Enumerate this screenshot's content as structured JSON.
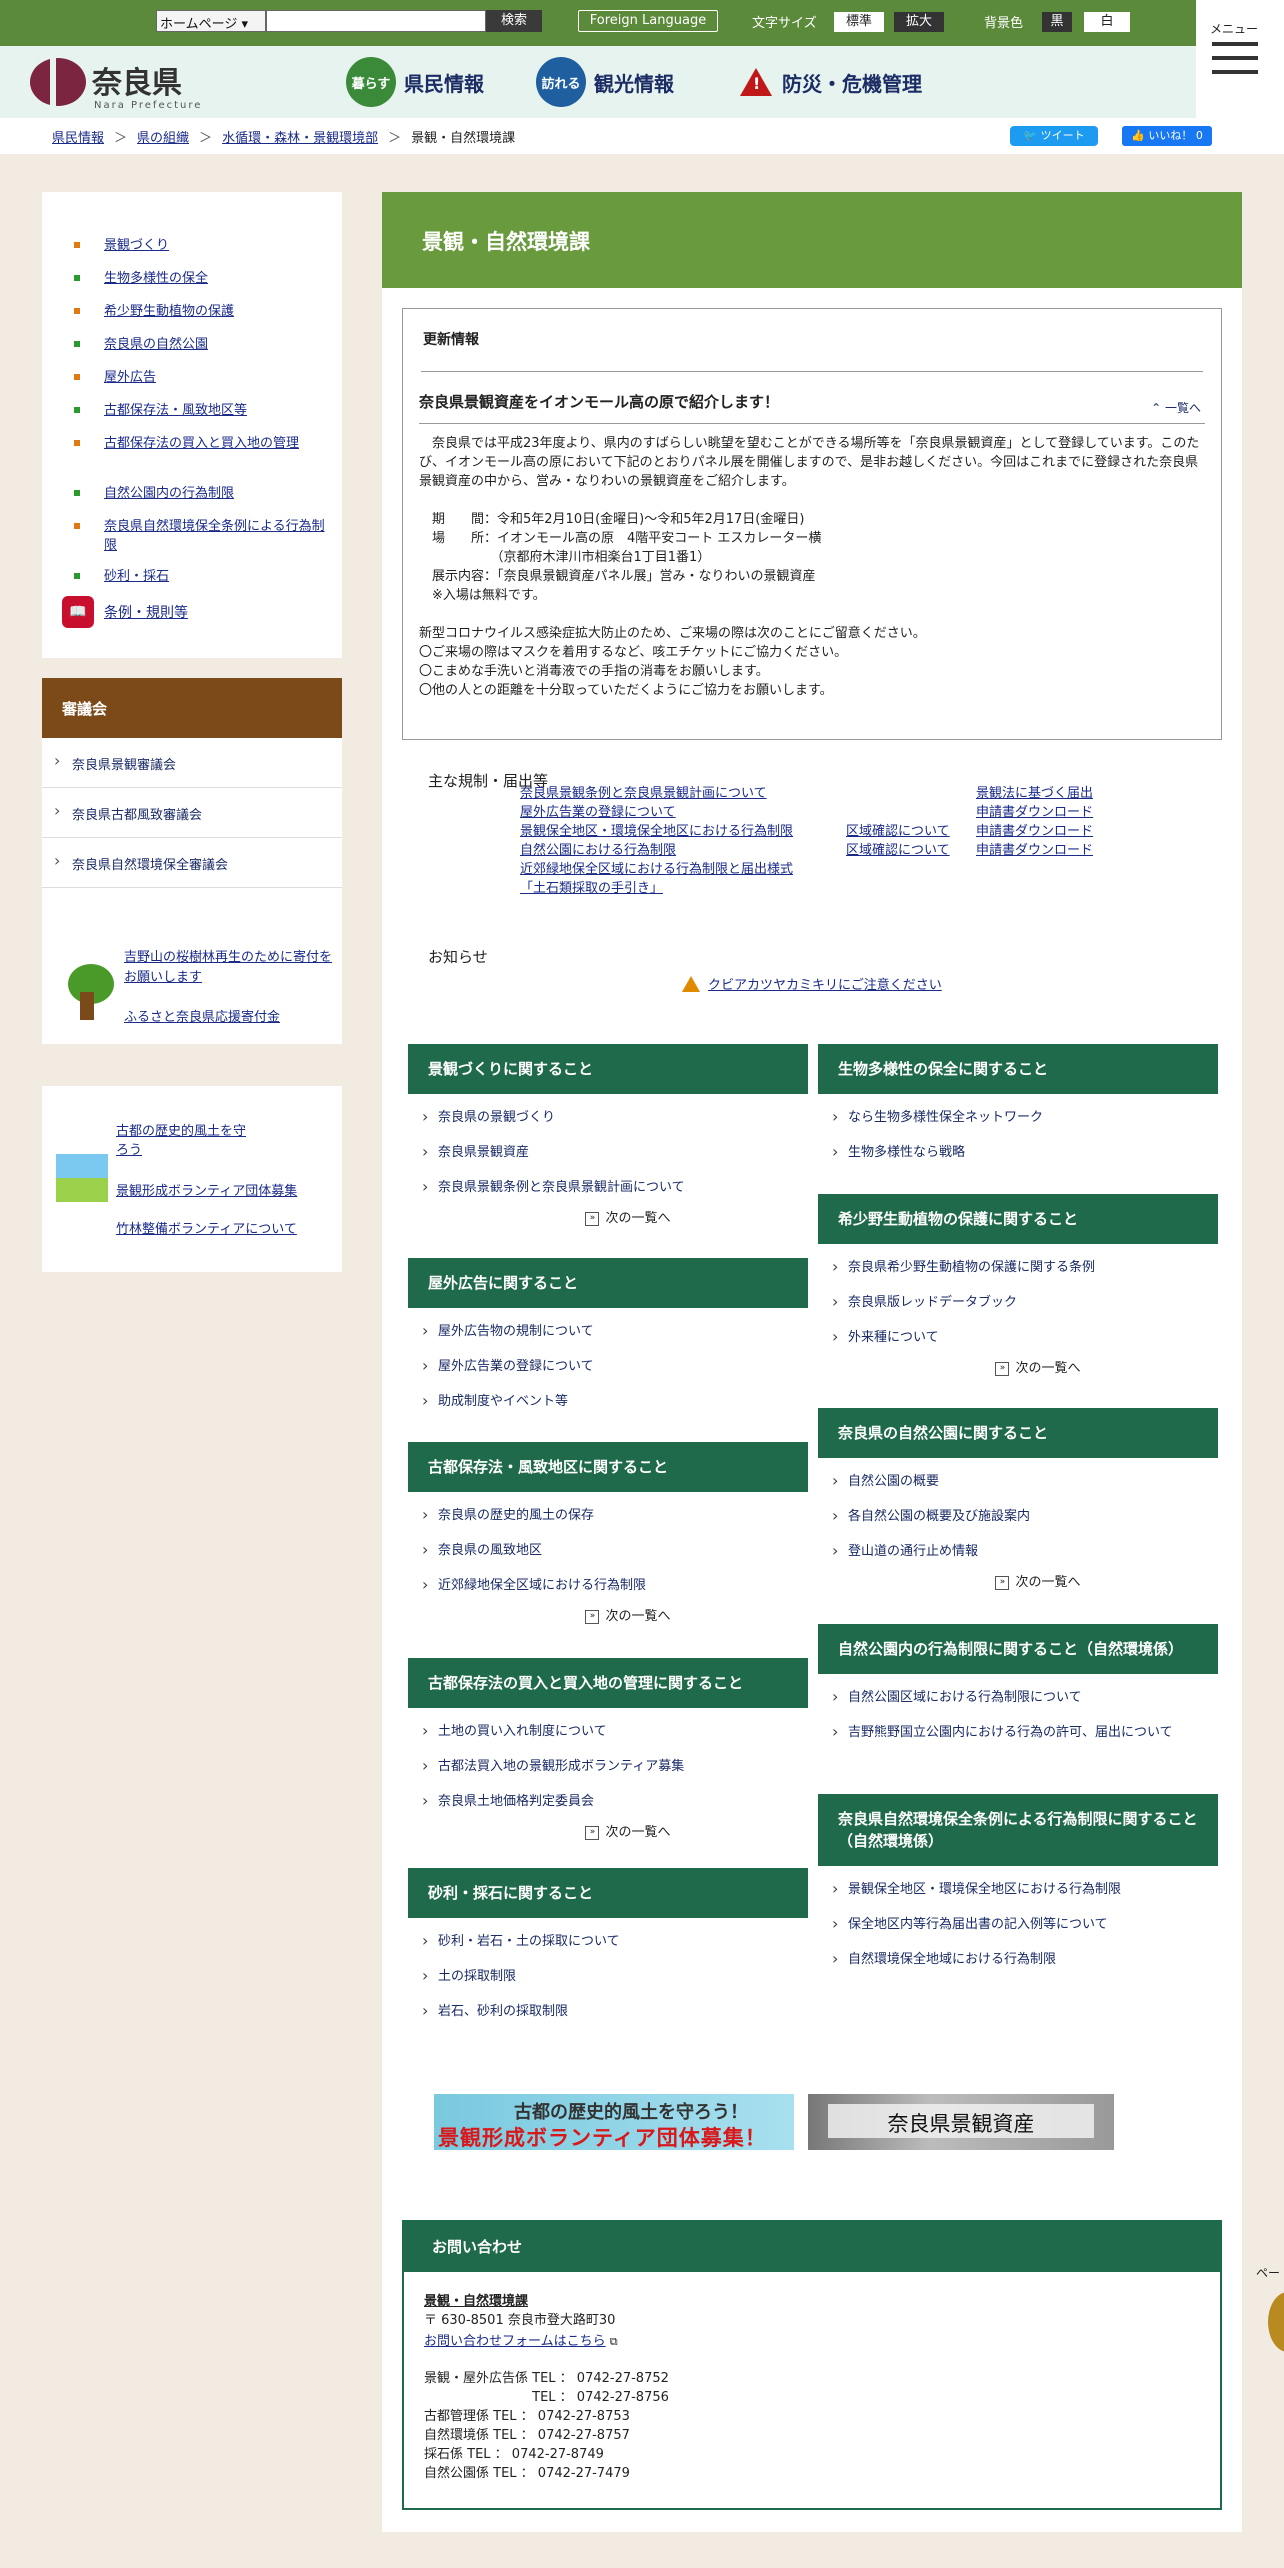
{
  "topbar": {
    "select_value": "ホームページ",
    "search_placeholder": "",
    "search_button": "検索",
    "foreign_language": "Foreign Language",
    "font_size_label": "文字サイズ",
    "font_standard": "標準",
    "font_large": "拡大",
    "bg_label": "背景色",
    "bg_black": "黒",
    "bg_white": "白"
  },
  "header": {
    "logo_text": "奈良県",
    "logo_sub": "Nara Prefecture",
    "nav": [
      {
        "badge": "暮らす",
        "label": "県民情報"
      },
      {
        "badge": "訪れる",
        "label": "観光情報"
      },
      {
        "badge": "",
        "label": "防災・危機管理"
      }
    ],
    "menu_label": "メニュー"
  },
  "breadcrumb": {
    "items": [
      "県民情報",
      "県の組織",
      "水循環・森林・景観環境部",
      "景観・自然環境課"
    ],
    "tweet": "ツイート",
    "like": "いいね！ 0"
  },
  "sidebar": {
    "links": [
      {
        "label": "景観づくり",
        "color": "#e07a10"
      },
      {
        "label": "生物多様性の保全",
        "color": "#2a9a2a"
      },
      {
        "label": "希少野生動植物の保護",
        "color": "#e07a10"
      },
      {
        "label": "奈良県の自然公園",
        "color": "#2a9a2a"
      },
      {
        "label": "屋外広告",
        "color": "#e07a10"
      },
      {
        "label": "古都保存法・風致地区等",
        "color": "#2a9a2a"
      },
      {
        "label": "古都保存法の買入と買入地の管理",
        "color": "#e07a10"
      },
      {
        "label": "自然公園内の行為制限",
        "color": "#2a9a2a"
      },
      {
        "label": "奈良県自然環境保全条例による行為制限",
        "color": "#e07a10"
      },
      {
        "label": "砂利・採石",
        "color": "#2a9a2a"
      }
    ],
    "rules_label": "条例・規則等",
    "council_header": "審議会",
    "councils": [
      "奈良県景観審議会",
      "奈良県古都風致審議会",
      "奈良県自然環境保全審議会"
    ],
    "donation_link1": "吉野山の桜樹林再生のために寄付をお願いします",
    "donation_link2": "ふるさと奈良県応援寄付金",
    "volunteer_link1": "古都の歴史的風土を守ろう",
    "volunteer_link2": "景観形成ボランティア団体募集",
    "volunteer_link3": "竹林整備ボランティアについて"
  },
  "main": {
    "title": "景観・自然環境課",
    "update_header": "更新情報",
    "update_title": "奈良県景観資産をイオンモール高の原で紹介します！",
    "update_list_link": "一覧へ",
    "update_body": [
      "　奈良県では平成23年度より、県内のすばらしい眺望を望むことができる場所等を「奈良県景観資産」として登録しています。このたび、イオンモール高の原において下記のとおりパネル展を開催しますので、是非お越しください。今回はこれまでに登録された奈良県景観資産の中から、営み・なりわいの景観資産をご紹介します。",
      "",
      "　期　　間：令和5年2月10日(金曜日)～令和5年2月17日(金曜日)",
      "　場　　所：イオンモール高の原　4階平安コート エスカレーター横",
      "　　　　　　（京都府木津川市相楽台1丁目1番1）",
      "　展示内容：「奈良県景観資産パネル展」営み・なりわいの景観資産",
      "　※入場は無料です。",
      "",
      "新型コロナウイルス感染症拡大防止のため、ご来場の際は次のことにご留意ください。",
      "〇ご来場の際はマスクを着用するなど、咳エチケットにご協力ください。",
      "〇こまめな手洗いと消毒液での手指の消毒をお願いします。",
      "〇他の人との距離を十分取っていただくようにご協力をお願いします。"
    ],
    "regs_header": "主な規制・届出等",
    "regs_col1": [
      "奈良県景観条例と奈良県景観計画について",
      "屋外広告業の登録について",
      "景観保全地区・環境保全地区における行為制限",
      "自然公園における行為制限",
      "近郊緑地保全区域における行為制限と届出様式",
      "「土石類採取の手引き」"
    ],
    "regs_col2": [
      "区域確認について",
      "区域確認について"
    ],
    "regs_col3": [
      "景観法に基づく届出",
      "申請書ダウンロード",
      "申請書ダウンロード",
      "申請書ダウンロード"
    ],
    "notice_header": "お知らせ",
    "notice_link": "クビアカツヤカミキリにご注意ください",
    "more_label": "次の一覧へ",
    "left_cats": [
      {
        "title": "景観づくりに関すること",
        "items": [
          "奈良県の景観づくり",
          "奈良県景観資産",
          "奈良県景観条例と奈良県景観計画について"
        ],
        "more": true
      },
      {
        "title": "屋外広告に関すること",
        "items": [
          "屋外広告物の規制について",
          "屋外広告業の登録について",
          "助成制度やイベント等"
        ],
        "more": false
      },
      {
        "title": "古都保存法・風致地区に関すること",
        "items": [
          "奈良県の歴史的風土の保存",
          "奈良県の風致地区",
          "近郊緑地保全区域における行為制限"
        ],
        "more": true
      },
      {
        "title": "古都保存法の買入と買入地の管理に関すること",
        "items": [
          "土地の買い入れ制度について",
          "古都法買入地の景観形成ボランティア募集",
          "奈良県土地価格判定委員会"
        ],
        "more": true
      },
      {
        "title": "砂利・採石に関すること",
        "items": [
          "砂利・岩石・土の採取について",
          "土の採取制限",
          "岩石、砂利の採取制限"
        ],
        "more": false
      }
    ],
    "right_cats": [
      {
        "title": "生物多様性の保全に関すること",
        "items": [
          "なら生物多様性保全ネットワーク",
          "生物多様性なら戦略"
        ],
        "more": false
      },
      {
        "title": "希少野生動植物の保護に関すること",
        "items": [
          "奈良県希少野生動植物の保護に関する条例",
          "奈良県版レッドデータブック",
          "外来種について"
        ],
        "more": true
      },
      {
        "title": "奈良県の自然公園に関すること",
        "items": [
          "自然公園の概要",
          "各自然公園の概要及び施設案内",
          "登山道の通行止め情報"
        ],
        "more": true
      },
      {
        "title": "自然公園内の行為制限に関すること（自然環境係）",
        "items": [
          "自然公園区域における行為制限について",
          "吉野熊野国立公園内における行為の許可、届出について"
        ],
        "more": false
      },
      {
        "title": "奈良県自然環境保全条例による行為制限に関すること（自然環境係）",
        "items": [
          "景観保全地区・環境保全地区における行為制限",
          "保全地区内等行為届出書の記入例等について",
          "自然環境保全地域における行為制限"
        ],
        "more": false
      }
    ],
    "banner1_line1": "古都の歴史的風土を守ろう！",
    "banner1_line2": "景観形成ボランティア団体募集！",
    "banner2": "奈良県景観資産",
    "contact_header": "お問い合わせ",
    "contact_dept": "景観・自然環境課",
    "contact_address": "〒 630-8501 奈良市登大路町30",
    "contact_form": "お問い合わせフォームはこちら",
    "contact_lines": [
      "景観・屋外広告係 TEL ： 0742-27-8752",
      "　　　　　　　　 TEL ： 0742-27-8756",
      "古都管理係 TEL ： 0742-27-8753",
      "自然環境係 TEL ： 0742-27-8757",
      "採石係 TEL ： 0742-27-8749",
      "自然公園係 TEL ： 0742-27-7479"
    ],
    "page_side": "ペー"
  }
}
